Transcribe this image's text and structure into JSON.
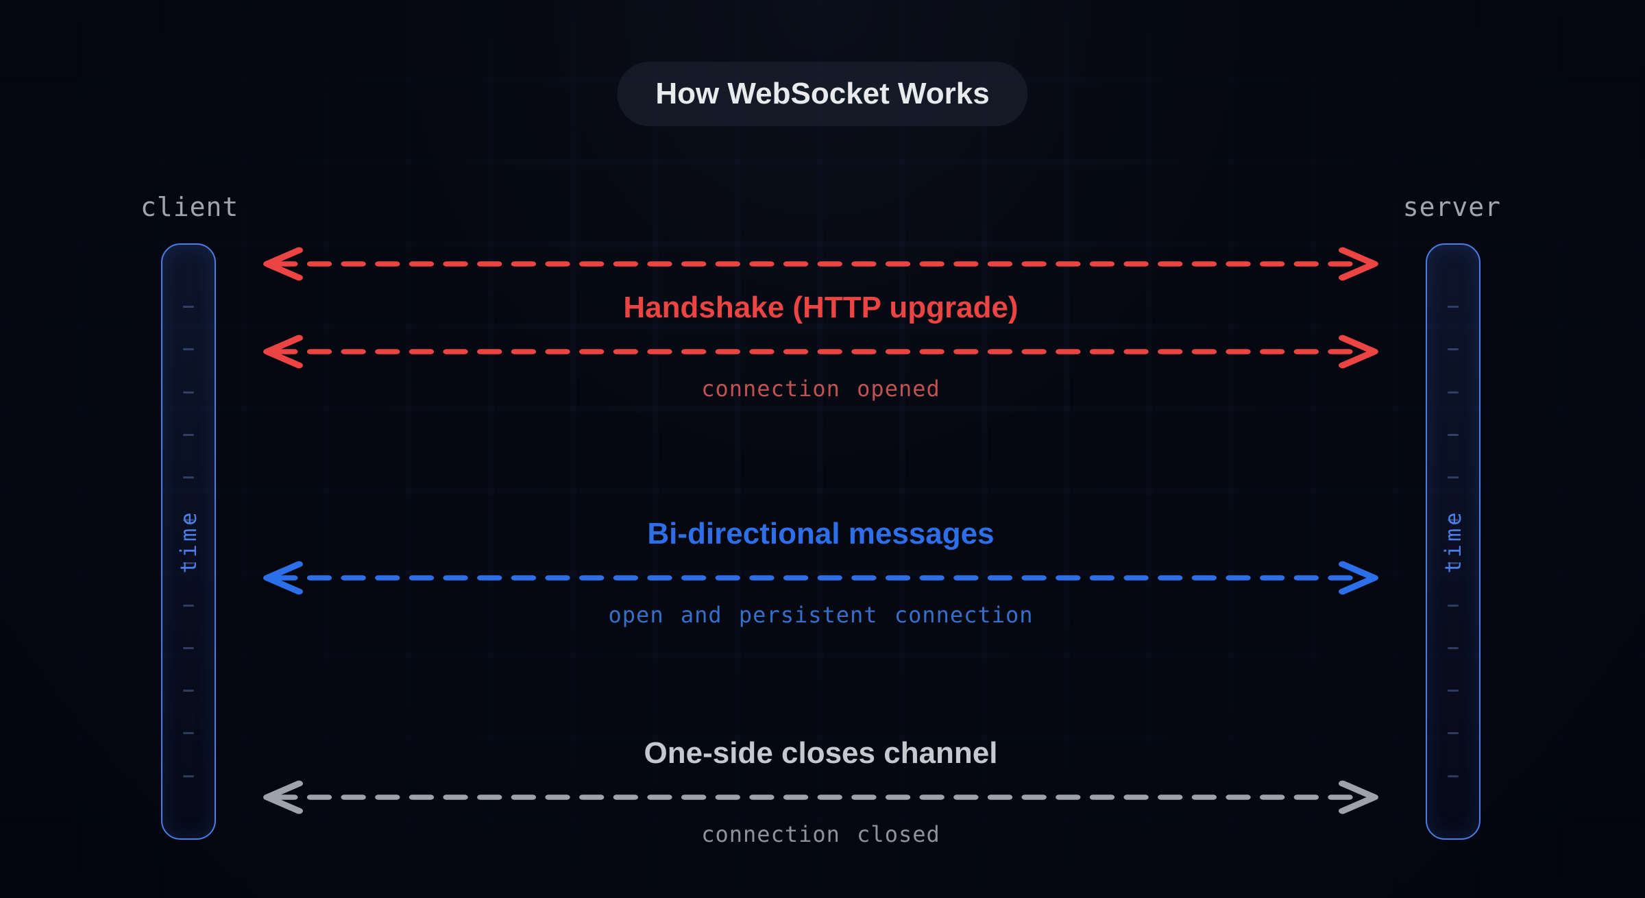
{
  "title": "How WebSocket Works",
  "actors": {
    "client": "client",
    "server": "server"
  },
  "time_label": "time",
  "phases": [
    {
      "id": "handshake",
      "headline": "Handshake (HTTP upgrade)",
      "subline": "connection opened",
      "color": "#ec4343",
      "arrows": 2
    },
    {
      "id": "bidirectional",
      "headline": "Bi-directional messages",
      "subline": "open and persistent connection",
      "color": "#2c6fe8",
      "arrows": 1
    },
    {
      "id": "close",
      "headline": "One-side closes channel",
      "subline": "connection closed",
      "color": "#9da2ac",
      "arrows": 1
    }
  ]
}
